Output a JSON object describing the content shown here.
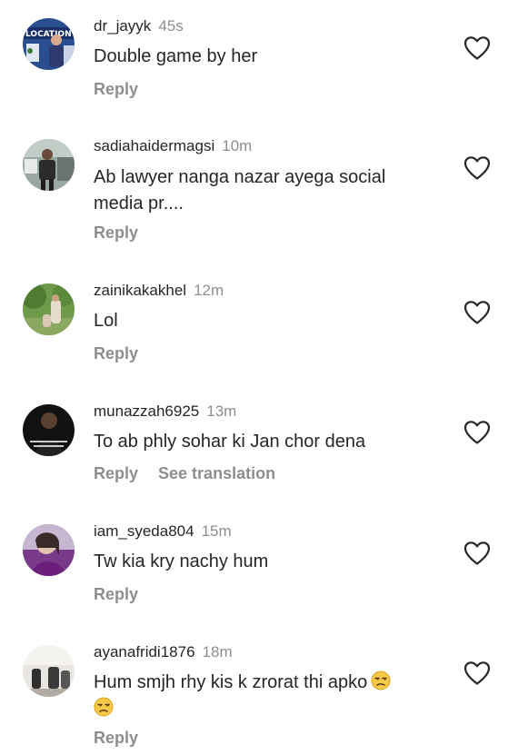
{
  "colors": {
    "text": "#262626",
    "secondary": "#8e8e8e",
    "background": "#ffffff"
  },
  "icons": {
    "like": "heart-outline-icon",
    "emoji": "unamused-face-emoji"
  },
  "comments": [
    {
      "username": "dr_jayyk",
      "time": "45s",
      "text": "Double game by her",
      "reply_label": "Reply",
      "avatar_logo_text": "LOCATION"
    },
    {
      "username": "sadiahaidermagsi",
      "time": "10m",
      "text": "Ab lawyer nanga nazar ayega social media pr....",
      "reply_label": "Reply"
    },
    {
      "username": "zainikakakhel",
      "time": "12m",
      "text": "Lol",
      "reply_label": "Reply"
    },
    {
      "username": "munazzah6925",
      "time": "13m",
      "text": "To ab phly sohar ki Jan chor dena",
      "reply_label": "Reply",
      "translate_label": "See translation"
    },
    {
      "username": "iam_syeda804",
      "time": "15m",
      "text": "Tw kia kry nachy hum",
      "reply_label": "Reply"
    },
    {
      "username": "ayanafridi1876",
      "time": "18m",
      "text": "Hum smjh rhy kis k zrorat thi apko",
      "reply_label": "Reply"
    }
  ]
}
